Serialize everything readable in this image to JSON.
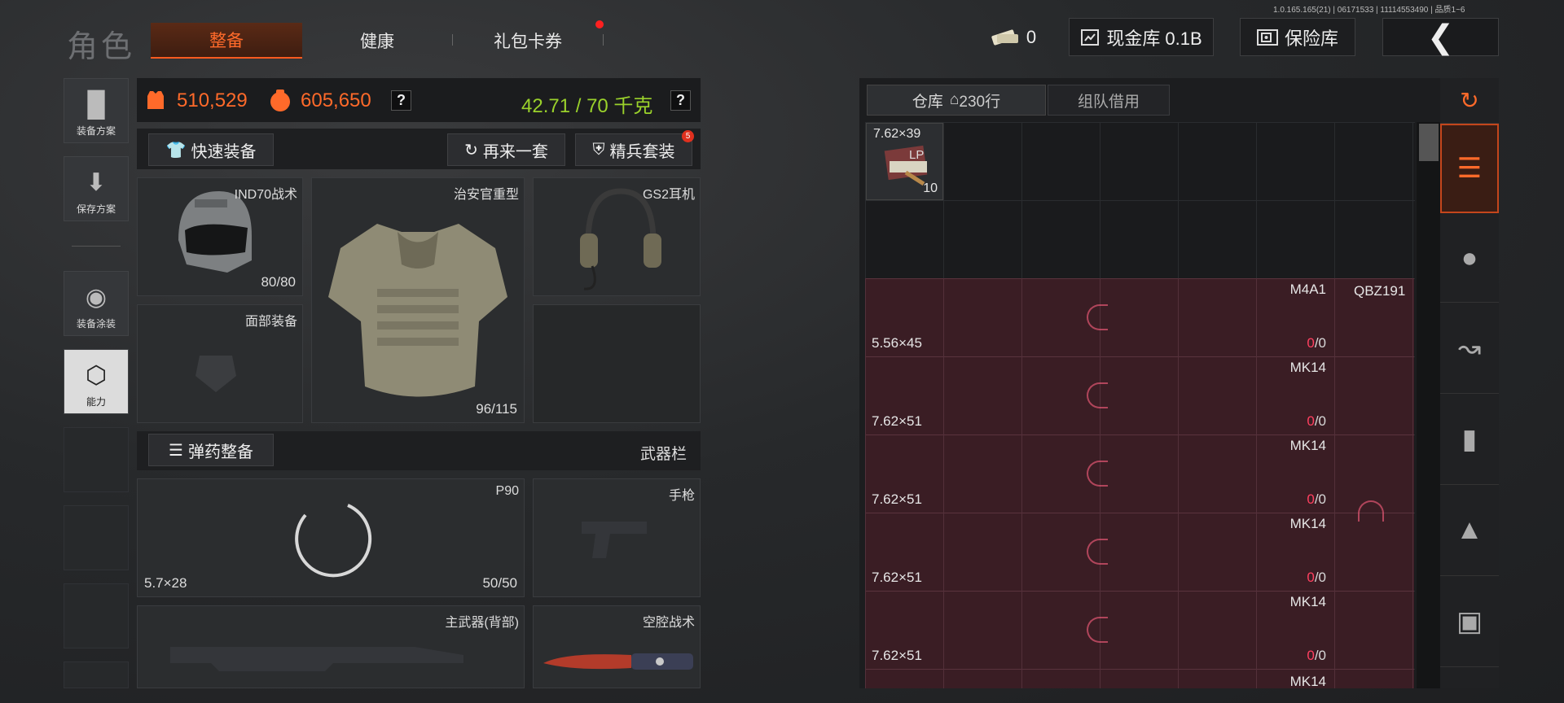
{
  "version": "1.0.165.165(21) | 06171533 | 11114553490 | 品质1~6",
  "header": {
    "title": "角色",
    "tabs": [
      "整备",
      "健康",
      "礼包卡券"
    ],
    "tickets": "0",
    "cash_vault": "现金库 0.1B",
    "safe_vault": "保险库",
    "back": "❮"
  },
  "sidebar": {
    "items": [
      {
        "label": "装备方案",
        "icon": "vest-icon"
      },
      {
        "label": "保存方案",
        "icon": "download-icon"
      },
      {
        "label": "装备涂装",
        "icon": "paint-icon"
      },
      {
        "label": "能力",
        "icon": "ability-icon"
      }
    ]
  },
  "stats": {
    "value_a": "510,529",
    "value_b": "605,650",
    "weight": "42.71 / 70 千克",
    "help": "?"
  },
  "buttons": {
    "quick_equip": "快速装备",
    "again": "再来一套",
    "elite": "精兵套装",
    "elite_badge": "5",
    "ammo_equip": "弹药整备",
    "weapon_bar": "武器栏"
  },
  "slots": {
    "helmet": {
      "name": "IND70战术",
      "durability": "80/80"
    },
    "armor": {
      "name": "治安官重型",
      "durability": "96/115"
    },
    "headset": {
      "name": "GS2耳机"
    },
    "face": {
      "name": "面部装备"
    },
    "primary": {
      "name": "P90",
      "caliber": "5.7×28",
      "ammo": "50/50"
    },
    "pistol": {
      "name": "手枪"
    },
    "back_weapon": {
      "name": "主武器(背部)"
    },
    "melee": {
      "name": "空腔战术"
    }
  },
  "warehouse": {
    "tab_storage": "仓库",
    "rows_count": "230行",
    "tab_team": "组队借用",
    "first_item": {
      "caliber": "7.62×39",
      "tag": "LP",
      "count": "10"
    },
    "ammo_rows": [
      {
        "weapon": "M4A1",
        "caliber": "5.56×45",
        "zero": "0",
        "total": "/0"
      },
      {
        "weapon": "MK14",
        "caliber": "7.62×51",
        "zero": "0",
        "total": "/0"
      },
      {
        "weapon": "MK14",
        "caliber": "7.62×51",
        "zero": "0",
        "total": "/0"
      },
      {
        "weapon": "MK14",
        "caliber": "7.62×51",
        "zero": "0",
        "total": "/0"
      },
      {
        "weapon": "MK14",
        "caliber": "7.62×51",
        "zero": "0",
        "total": "/0"
      },
      {
        "weapon": "MK14",
        "caliber": "",
        "zero": "",
        "total": ""
      }
    ],
    "qbz": "QBZ191"
  },
  "filters": [
    "sort-icon",
    "all-items-icon",
    "helmet-icon",
    "rifle-icon",
    "magazine-icon",
    "bullet-icon",
    "scope-icon"
  ],
  "colors": {
    "accent": "#ff6a2a",
    "green": "#9ad12b",
    "red_zone": "#3a1d24"
  }
}
